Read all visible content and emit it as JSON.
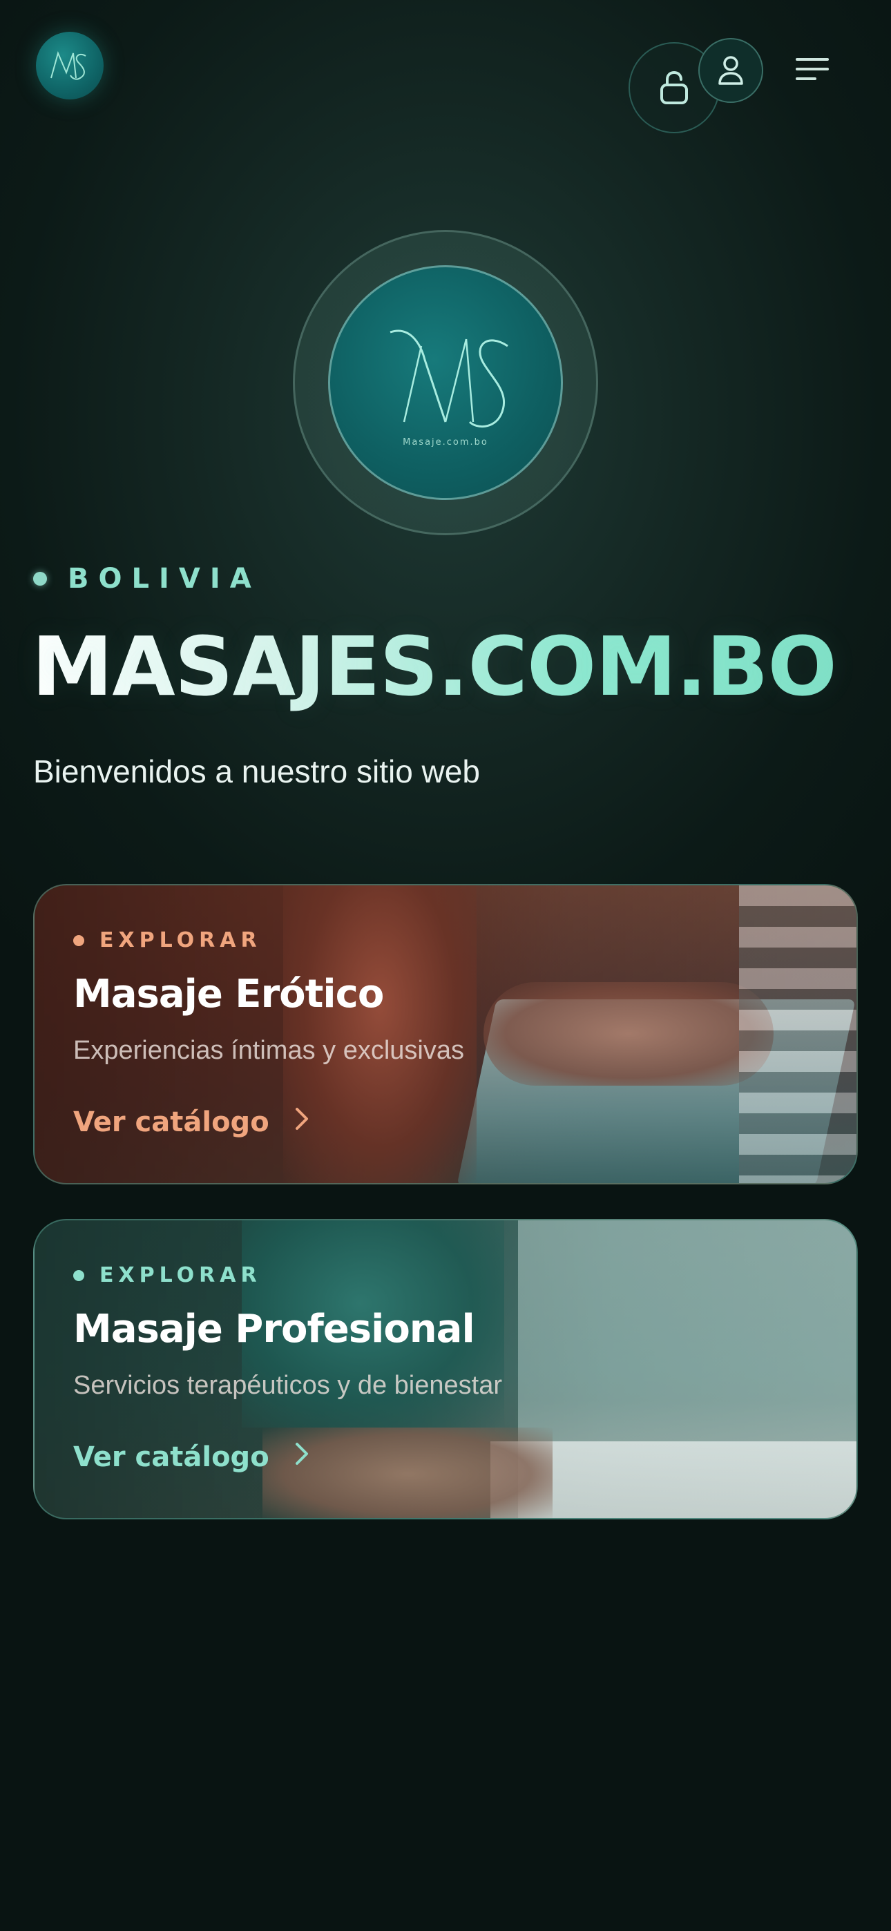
{
  "header": {
    "logo_text": "MS",
    "icons": [
      "lock-icon",
      "user-icon",
      "menu-icon"
    ]
  },
  "hero": {
    "logo_monogram": "MS",
    "logo_caption": "Masaje.com.bo",
    "country": "BOLIVIA",
    "site_title": "MASAJES.COM.BO",
    "welcome": "Bienvenidos a nuestro sitio web"
  },
  "cards": [
    {
      "kicker": "EXPLORAR",
      "title": "Masaje Erótico",
      "subtitle": "Experiencias íntimas y exclusivas",
      "cta": "Ver catálogo",
      "accent": "#f0a57e"
    },
    {
      "kicker": "EXPLORAR",
      "title": "Masaje Profesional",
      "subtitle": "Servicios terapéuticos y de bienestar",
      "cta": "Ver catálogo",
      "accent": "#8ee0cc"
    }
  ],
  "colors": {
    "background": "#0c1a17",
    "accent_teal": "#8ee0cc",
    "accent_peach": "#f0a57e",
    "logo_teal": "#0f6163"
  }
}
